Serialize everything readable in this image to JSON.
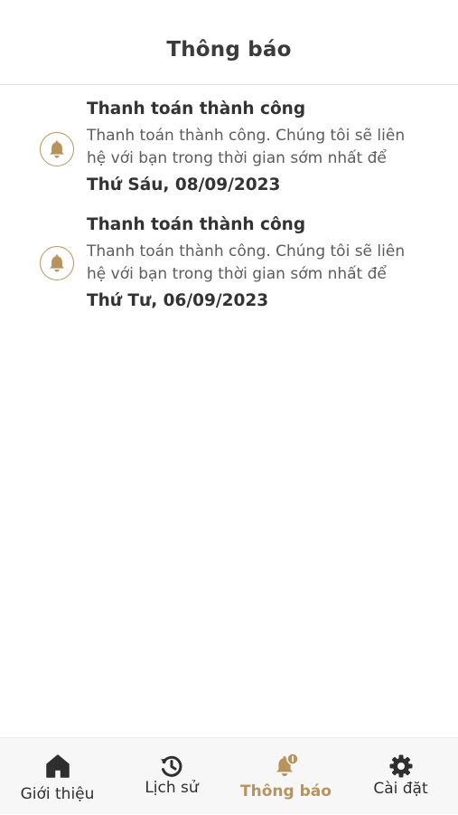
{
  "header": {
    "title": "Thông báo"
  },
  "notifications": [
    {
      "title": "Thanh toán thành công",
      "body": "Thanh toán thành công. Chúng tôi sẽ liên hệ với bạn trong thời gian sớm nhất để",
      "date": "Thứ Sáu, 08/09/2023",
      "icon": "bell-icon"
    },
    {
      "title": "Thanh toán thành công",
      "body": "Thanh toán thành công. Chúng tôi sẽ liên hệ với bạn trong thời gian sớm nhất để",
      "date": "Thứ Tư, 06/09/2023",
      "icon": "bell-icon"
    }
  ],
  "tabbar": {
    "tabs": [
      {
        "label": "Giới thiệu",
        "icon": "home-icon",
        "active": false
      },
      {
        "label": "Lịch sử",
        "icon": "history-icon",
        "active": false
      },
      {
        "label": "Thông báo",
        "icon": "bell-badge-icon",
        "active": true
      },
      {
        "label": "Cài đặt",
        "icon": "gear-icon",
        "active": false
      }
    ]
  },
  "colors": {
    "accent": "#b8945c",
    "text": "#333333",
    "muted": "#5c5c5c",
    "tabbar_bg": "#f7f7f7"
  }
}
